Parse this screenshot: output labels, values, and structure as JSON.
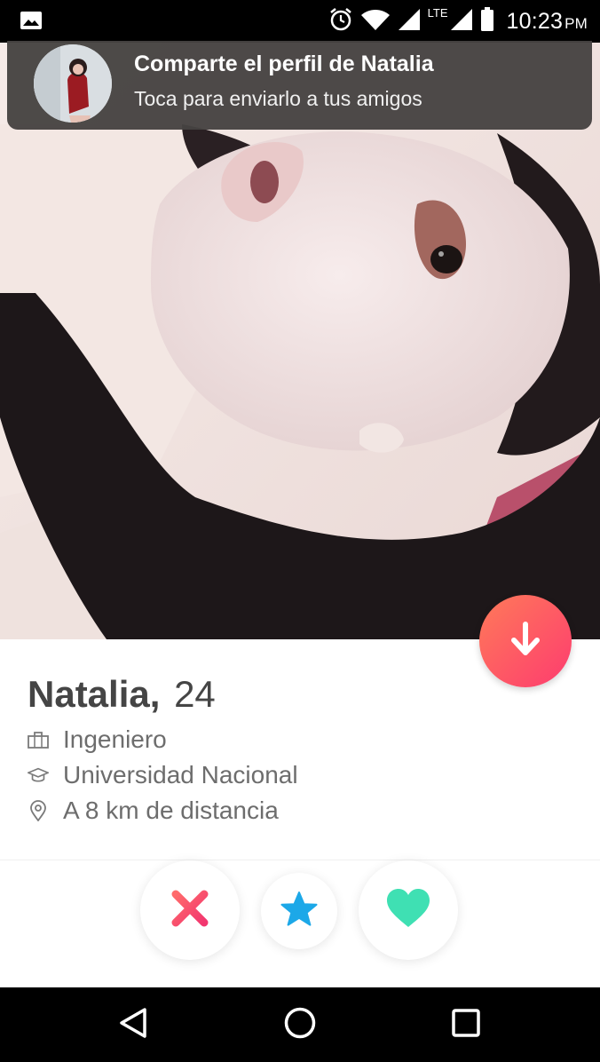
{
  "status_bar": {
    "network_label": "LTE",
    "time": "10:23",
    "ampm": "PM",
    "icons": [
      "image-icon",
      "alarm-icon",
      "wifi-icon",
      "signal-icon",
      "battery-icon"
    ]
  },
  "notification": {
    "title": "Comparte el perfil de Natalia",
    "subtitle": "Toca para enviarlo a tus amigos"
  },
  "profile": {
    "name": "Natalia,",
    "age": "24",
    "job": "Ingeniero",
    "school": "Universidad Nacional",
    "distance": "A 8 km de distancia"
  },
  "actions": {
    "nope_icon": "x-icon",
    "super_like_icon": "star-icon",
    "like_icon": "heart-icon"
  },
  "colors": {
    "accent_gradient_start": "#ff7a59",
    "accent_gradient_end": "#fd3c6f",
    "like": "#3fe0b3",
    "super_like": "#1ca8e8",
    "text_primary": "#454545",
    "text_secondary": "#6d6d6d"
  },
  "nav_bar": {
    "icons": [
      "back-icon",
      "home-icon",
      "recents-icon"
    ]
  }
}
